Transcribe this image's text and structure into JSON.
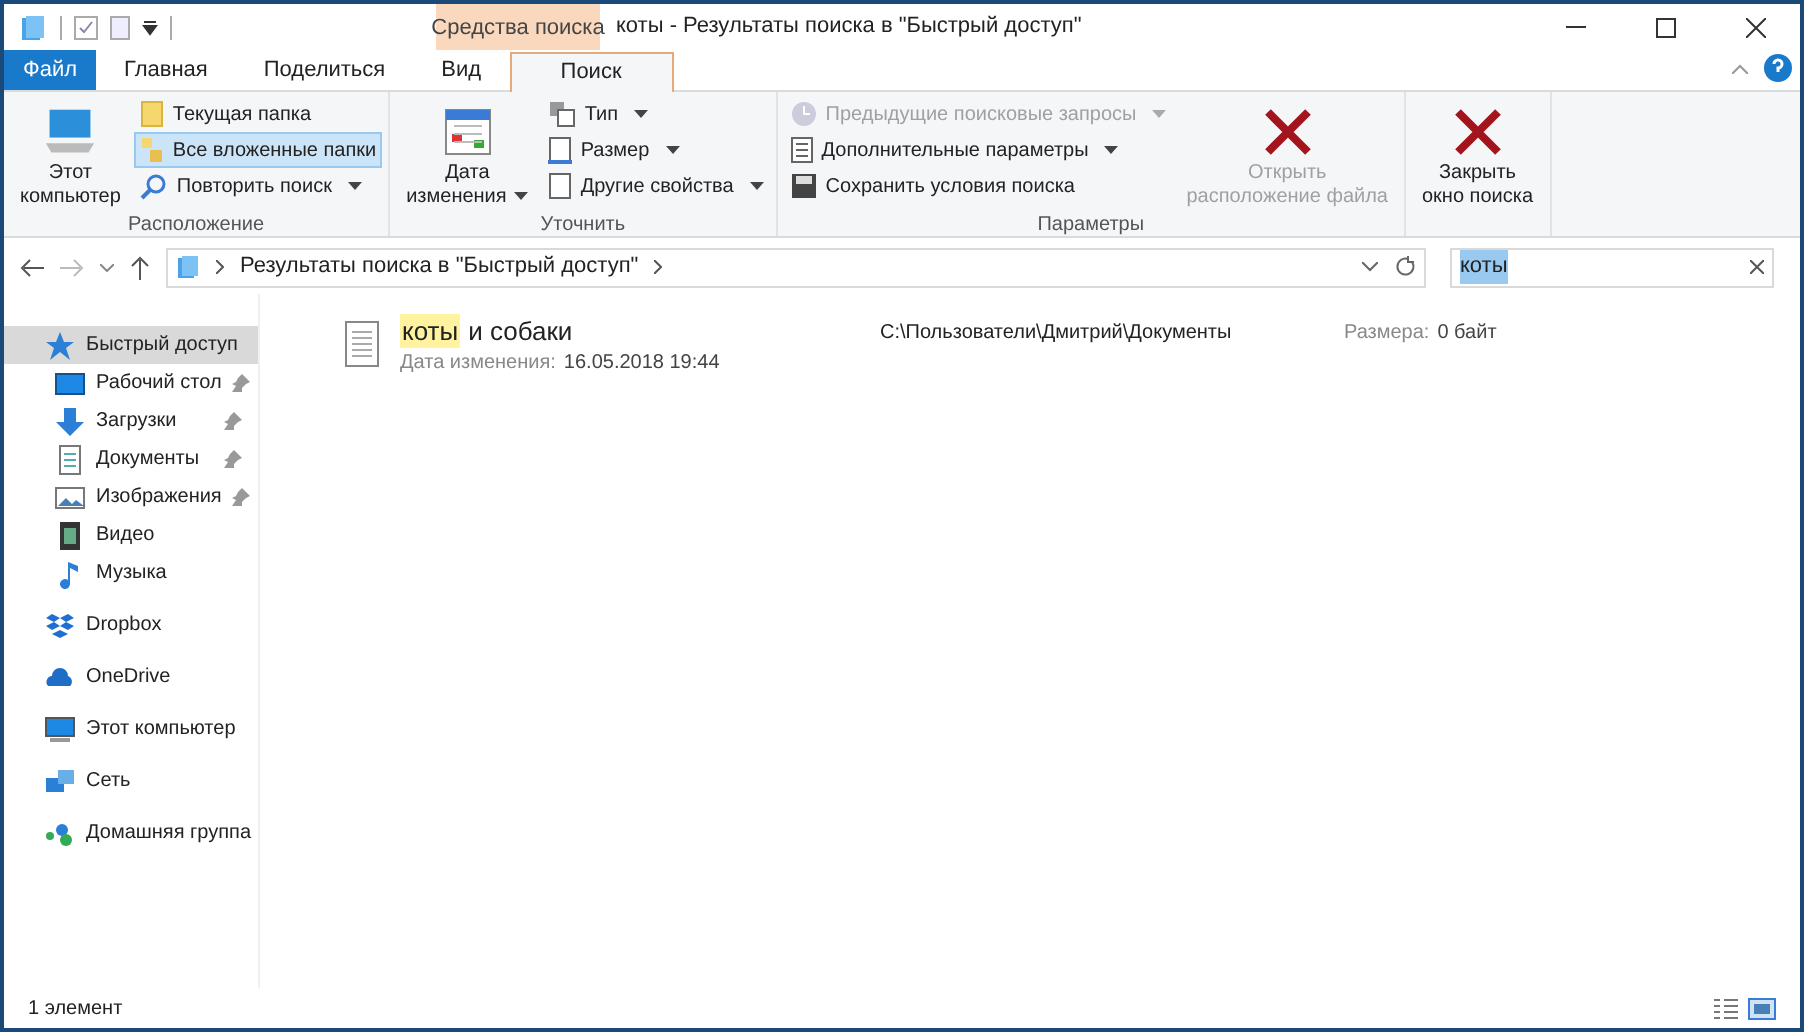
{
  "window": {
    "title": "коты - Результаты поиска в \"Быстрый доступ\""
  },
  "context_tab": {
    "label": "Средства поиска"
  },
  "tabs": [
    {
      "label": "Файл",
      "kind": "file",
      "selected": false
    },
    {
      "label": "Главная",
      "kind": "normal",
      "selected": false
    },
    {
      "label": "Поделиться",
      "kind": "normal",
      "selected": false
    },
    {
      "label": "Вид",
      "kind": "normal",
      "selected": false
    },
    {
      "label": "Поиск",
      "kind": "normal",
      "selected": true
    }
  ],
  "ribbon": {
    "groups": [
      {
        "label": "Расположение",
        "columns": [
          [
            {
              "label": "Этот\nкомпьютер",
              "kind": "large",
              "disabled": false,
              "dropdown": false,
              "selected": false
            }
          ],
          [
            {
              "label": "Текущая папка",
              "kind": "small",
              "disabled": false,
              "dropdown": false,
              "selected": false
            },
            {
              "label": "Все вложенные папки",
              "kind": "small",
              "disabled": false,
              "dropdown": false,
              "selected": true
            },
            {
              "label": "Повторить поиск",
              "kind": "small",
              "disabled": false,
              "dropdown": true,
              "selected": false
            }
          ]
        ]
      },
      {
        "label": "Уточнить",
        "columns": [
          [
            {
              "label": "Дата\nизменения",
              "kind": "large",
              "disabled": false,
              "dropdown": true,
              "selected": false
            }
          ],
          [
            {
              "label": "Тип",
              "kind": "small",
              "disabled": false,
              "dropdown": true,
              "selected": false
            },
            {
              "label": "Размер",
              "kind": "small",
              "disabled": false,
              "dropdown": true,
              "selected": false
            },
            {
              "label": "Другие свойства",
              "kind": "small",
              "disabled": false,
              "dropdown": true,
              "selected": false
            }
          ]
        ]
      },
      {
        "label": "Параметры",
        "columns": [
          [
            {
              "label": "Предыдущие поисковые запросы",
              "kind": "small",
              "disabled": true,
              "dropdown": true,
              "selected": false
            },
            {
              "label": "Дополнительные параметры",
              "kind": "small",
              "disabled": false,
              "dropdown": true,
              "selected": false
            },
            {
              "label": "Сохранить условия поиска",
              "kind": "small",
              "disabled": false,
              "dropdown": false,
              "selected": false
            }
          ],
          [
            {
              "label": "Открыть\nрасположение файла",
              "kind": "large",
              "disabled": true,
              "dropdown": false,
              "selected": false
            }
          ]
        ]
      },
      {
        "columns": [
          [
            {
              "label": "Закрыть\nокно поиска",
              "kind": "large",
              "disabled": false,
              "dropdown": false,
              "selected": false
            }
          ]
        ]
      }
    ]
  },
  "address": {
    "path": "Результаты поиска в \"Быстрый доступ\""
  },
  "search": {
    "value": "коты"
  },
  "sidebar": {
    "items": [
      {
        "label": "Быстрый доступ",
        "selected": true,
        "children": [
          {
            "label": "Рабочий стол",
            "pinned": true
          },
          {
            "label": "Загрузки",
            "pinned": true
          },
          {
            "label": "Документы",
            "pinned": true
          },
          {
            "label": "Изображения",
            "pinned": true
          },
          {
            "label": "Видео",
            "pinned": false
          },
          {
            "label": "Музыка",
            "pinned": false
          }
        ]
      },
      {
        "label": "Dropbox",
        "selected": false
      },
      {
        "label": "OneDrive",
        "selected": false
      },
      {
        "label": "Этот компьютер",
        "selected": false
      },
      {
        "label": "Сеть",
        "selected": false
      },
      {
        "label": "Домашняя группа",
        "selected": false
      }
    ]
  },
  "results": [
    {
      "name_match": "коты",
      "name_rest": "и собаки",
      "date_label": "Дата изменения:",
      "date_value": "16.05.2018 19:44",
      "path": "C:\\Пользователи\\Дмитрий\\Документы",
      "size_label": "Размера:",
      "size_value": "0 байт"
    }
  ],
  "status_bar": {
    "count": "1 элемент"
  }
}
